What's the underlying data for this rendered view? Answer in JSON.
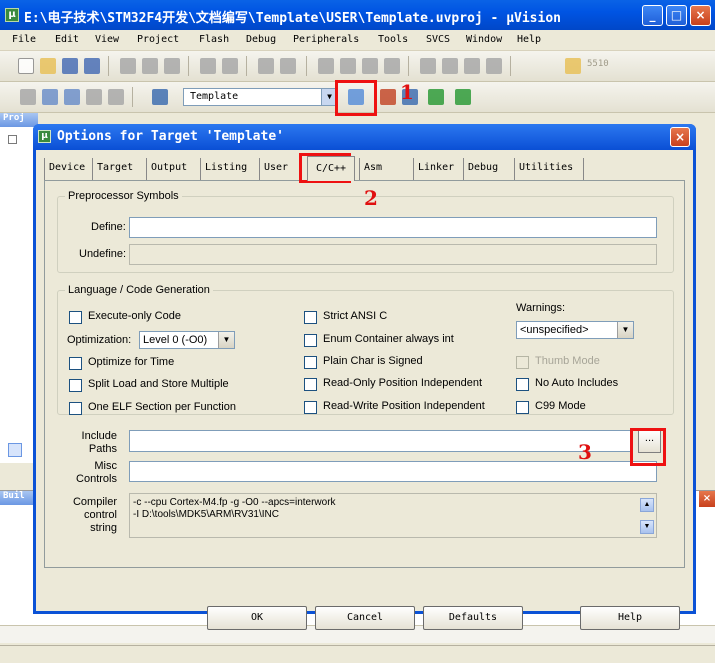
{
  "window": {
    "title": "E:\\电子技术\\STM32F4开发\\文档编写\\Template\\USER\\Template.uvproj - µVision",
    "app_icon": "μ",
    "controls": [
      "_",
      "□",
      "×"
    ]
  },
  "menu": [
    "File",
    "Edit",
    "View",
    "Project",
    "Flash",
    "Debug",
    "Peripherals",
    "Tools",
    "SVCS",
    "Window",
    "Help"
  ],
  "toolbar": {
    "search_value": "5510",
    "target_select": "Template"
  },
  "panes": {
    "project_label": "Proj",
    "build_label": "Buil"
  },
  "annotations": [
    "1",
    "2",
    "3"
  ],
  "dialog": {
    "icon": "μ",
    "title": "Options for Target 'Template'",
    "close": "×",
    "tabs": [
      "Device",
      "Target",
      "Output",
      "Listing",
      "User",
      "C/C++",
      "Asm",
      "Linker",
      "Debug",
      "Utilities"
    ],
    "active_tab": "C/C++",
    "preprocessor": {
      "legend": "Preprocessor Symbols",
      "define_label": "Define:",
      "define_value": "",
      "undefine_label": "Undefine:",
      "undefine_value": ""
    },
    "codegen": {
      "legend": "Language / Code Generation",
      "execute_only": "Execute-only Code",
      "optimization_label": "Optimization:",
      "optimization_value": "Level 0 (-O0)",
      "optimize_time": "Optimize for Time",
      "split_load": "Split Load and Store Multiple",
      "one_elf": "One ELF Section per Function",
      "strict_ansi": "Strict ANSI C",
      "enum_container": "Enum Container always int",
      "plain_char": "Plain Char is Signed",
      "ro_pos": "Read-Only Position Independent",
      "rw_pos": "Read-Write Position Independent",
      "warnings_label": "Warnings:",
      "warnings_value": "<unspecified>",
      "thumb_mode": "Thumb Mode",
      "no_auto": "No Auto Includes",
      "c99": "C99 Mode"
    },
    "include_label_1": "Include",
    "include_label_2": "Paths",
    "include_value": "",
    "browse": "...",
    "misc_label_1": "Misc",
    "misc_label_2": "Controls",
    "misc_value": "",
    "compiler_label_1": "Compiler",
    "compiler_label_2": "control",
    "compiler_label_3": "string",
    "compiler_line_1": "-c --cpu Cortex-M4.fp -g -O0 --apcs=interwork",
    "compiler_line_2": "-I D:\\tools\\MDK5\\ARM\\RV31\\INC",
    "buttons": {
      "ok": "OK",
      "cancel": "Cancel",
      "defaults": "Defaults",
      "help": "Help"
    }
  }
}
